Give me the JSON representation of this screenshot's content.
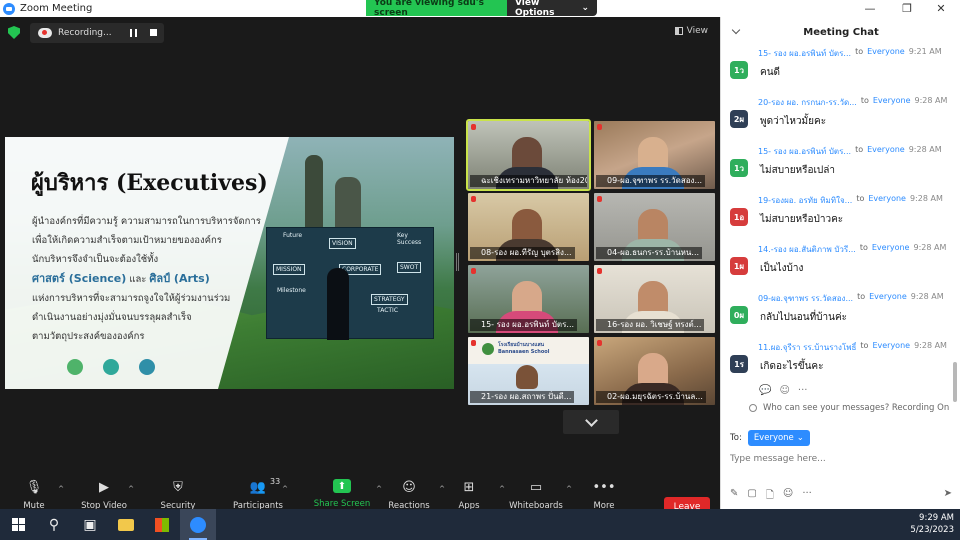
{
  "window": {
    "title": "Zoom Meeting",
    "minimize": "—",
    "maximize": "❐",
    "close": "✕"
  },
  "banner": {
    "viewing": "You are viewing sdu's screen",
    "view_options": "View Options",
    "caret": "⌄"
  },
  "recording": {
    "label": "Recording..."
  },
  "view_button": {
    "label": "View"
  },
  "slide": {
    "title": "ผู้บริหาร (Executives)",
    "lines": [
      "ผู้นำองค์กรที่มีความรู้ ความสามารถในการบริหารจัดการ",
      "เพื่อให้เกิดความสำเร็จตามเป้าหมายขององค์กร",
      "นักบริหารจึงจำเป็นจะต้องใช้ทั้ง"
    ],
    "highlight_science": "ศาสตร์ (Science)",
    "and_word": " และ ",
    "highlight_arts": "ศิลป์ (Arts)",
    "lines2": [
      "แห่งการบริหารที่จะสามารถจูงใจให้ผู้ร่วมงานร่วม",
      "ดำเนินงานอย่างมุ่งมั่นจนบรรลุผลสำเร็จ",
      "ตามวัตถุประสงค์ขององค์กร"
    ],
    "dot_colors": [
      "#4fb36a",
      "#2fa89a",
      "#2f8fa8"
    ],
    "board_labels": {
      "future": "Future",
      "vision": "VISION",
      "key_success": "Key Success",
      "mission": "MISSION",
      "corporate": "CORPORATE",
      "swot": "SWOT",
      "milestone": "Milestone",
      "strategy": "STRATEGY",
      "tactic": "TACTIC"
    }
  },
  "participants": [
    {
      "name": "ฉะเชิงเทรามหาวิทยาลัย ห้อง202",
      "active": true
    },
    {
      "name": "09-ผอ.จุฑาพร  รร.วัดสอง..."
    },
    {
      "name": "08-รอง ผอ.ทีรัญ บุตรสิง..."
    },
    {
      "name": "04-ผอ.ธนกร-รร.บ้านหน..."
    },
    {
      "name": "15- รอง ผอ.อรพินท์ บัตร..."
    },
    {
      "name": "16-รอง ผอ. วิเชษฐ์ ทรงต์..."
    },
    {
      "name": "21-รอง ผอ.สถาพร ปั่นดี..."
    },
    {
      "name": "02-ผอ.มยุรฉัตร-รร.บ้านล..."
    }
  ],
  "participant_banner": {
    "school_th": "โรงเรียนบ้านบางแสน",
    "school_en": "Bannasaen School"
  },
  "toolbar": {
    "mute": "Mute",
    "stop_video": "Stop Video",
    "security": "Security",
    "participants": "Participants",
    "participants_count": "33",
    "share_screen": "Share Screen",
    "reactions": "Reactions",
    "apps": "Apps",
    "whiteboards": "Whiteboards",
    "more": "More",
    "leave": "Leave",
    "caret": "^"
  },
  "chat": {
    "title": "Meeting Chat",
    "messages": [
      {
        "avatar": "1ว",
        "color": "#2fae5c",
        "sender": "15- รอง ผอ.อรพินท์ บัตร...",
        "to": "to",
        "everyone": "Everyone",
        "time": "9:21 AM",
        "text": "คนดี"
      },
      {
        "avatar": "2ผ",
        "color": "#2f3f56",
        "sender": "20-รอง ผอ. กรกนก-รร.วัด...",
        "to": "to",
        "everyone": "Everyone",
        "time": "9:28 AM",
        "text": "พูดว่าไหวมั้ยคะ"
      },
      {
        "avatar": "1ว",
        "color": "#2fae5c",
        "sender": "15- รอง ผอ.อรพินท์ บัตร...",
        "to": "to",
        "everyone": "Everyone",
        "time": "9:28 AM",
        "text": "ไม่สบายหรือเปล่า"
      },
      {
        "avatar": "1อ",
        "color": "#d63c3c",
        "sender": "19-รองผอ. อรทัย ทิมทิใจ...",
        "to": "to",
        "everyone": "Everyone",
        "time": "9:28 AM",
        "text": "ไม่สบายหรือป่าวคะ"
      },
      {
        "avatar": "1ผ",
        "color": "#d63c3c",
        "sender": "14.-รอง ผอ.สันติภาพ บัวรี...",
        "to": "to",
        "everyone": "Everyone",
        "time": "9:28 AM",
        "text": "เป็นไงบ้าง"
      },
      {
        "avatar": "0ผ",
        "color": "#2fae5c",
        "sender": "09-ผอ.จุฑาพร  รร.วัดสอง...",
        "to": "to",
        "everyone": "Everyone",
        "time": "9:28 AM",
        "text": "กลับไปนอนที่บ้านค่ะ"
      },
      {
        "avatar": "1ร",
        "color": "#2f3f56",
        "sender": "11.ผอ.จุรีรา รร.บ้านรางโพธิ์",
        "to": "to",
        "everyone": "Everyone",
        "time": "9:28 AM",
        "text": "เกิดอะไรขึ้นคะ"
      }
    ],
    "privacy_note": "Who can see your messages? Recording On",
    "to_label": "To:",
    "to_value": "Everyone",
    "input_placeholder": "Type message here...",
    "input_value": ""
  },
  "taskbar": {
    "time": "9:29 AM",
    "date": "5/23/2023"
  }
}
